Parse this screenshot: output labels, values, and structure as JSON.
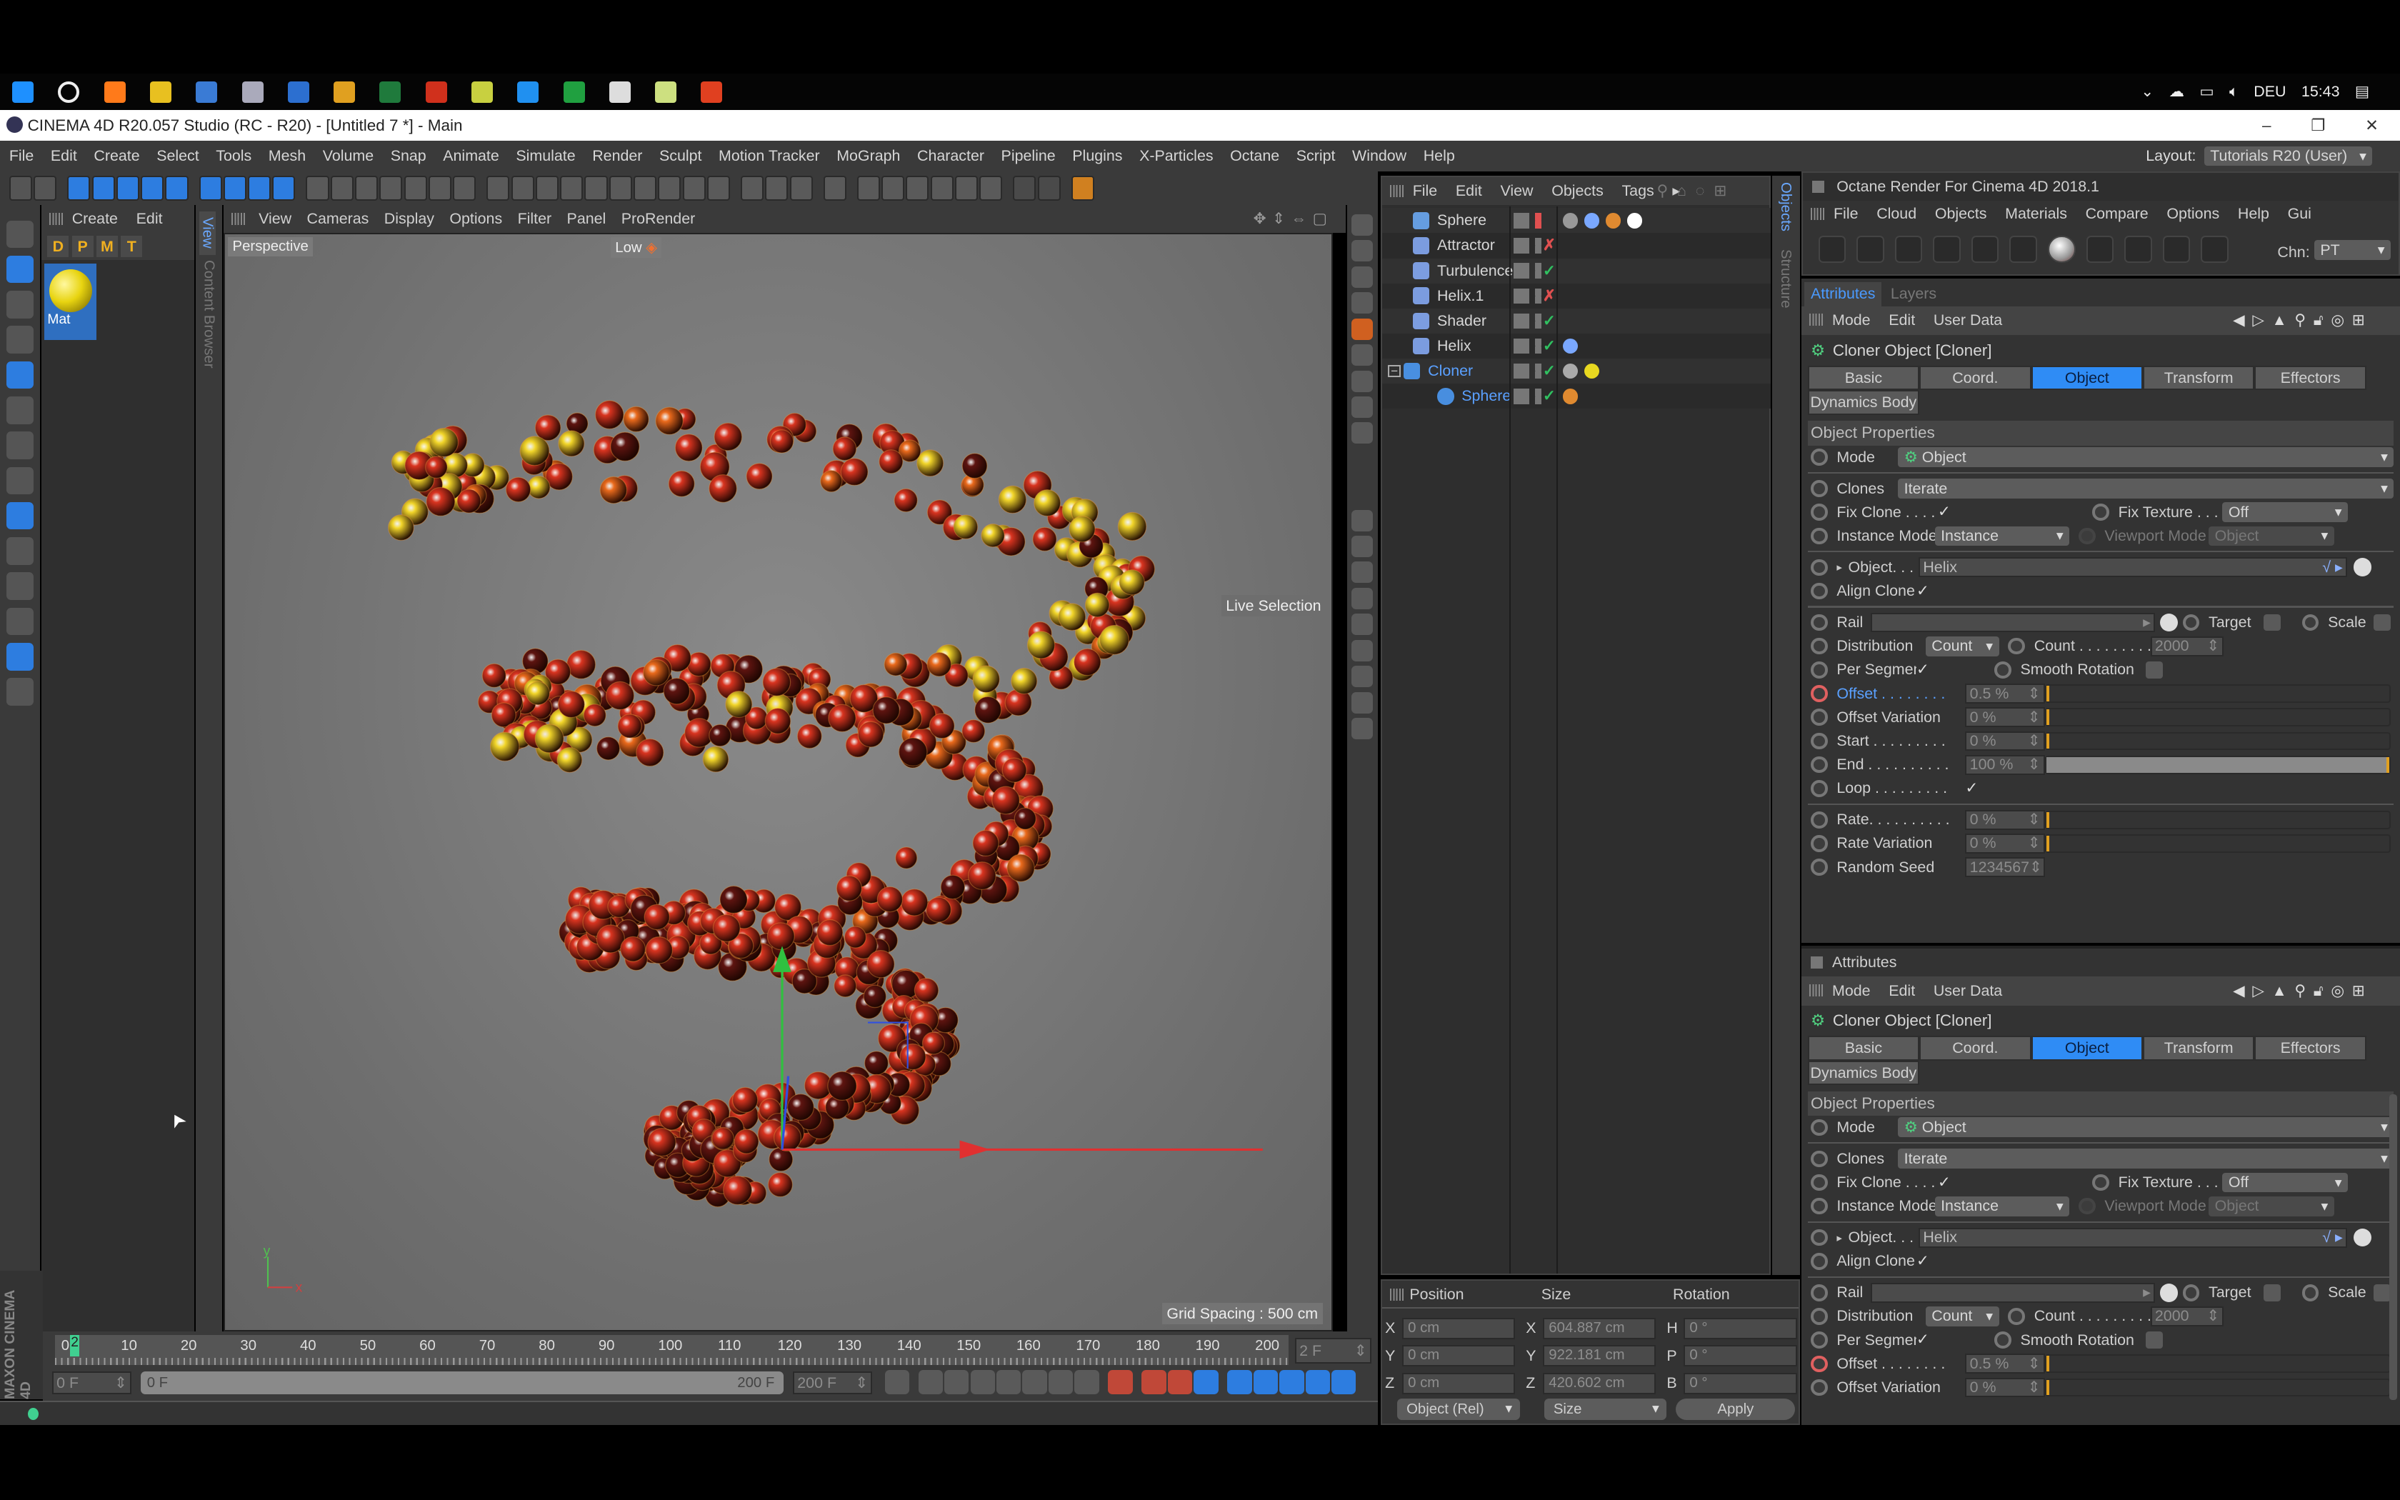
{
  "taskbar": {
    "apps": [
      "windows-icon",
      "cortana-icon",
      "firefox-icon",
      "chrome-icon",
      "simplenote-icon",
      "cinema4d-icon",
      "photoshop-icon",
      "premiere-icon",
      "excel-icon",
      "acrobat-icon",
      "quixel-icon",
      "skype-icon",
      "camtasia-icon",
      "c4d-launcher-icon",
      "notepad-icon",
      "recorder-icon"
    ],
    "lang": "DEU",
    "time": "15:43"
  },
  "window": {
    "title": "CINEMA 4D R20.057 Studio (RC - R20) - [Untitled 7 *] - Main",
    "minimize": "–",
    "restore": "❐",
    "close": "✕"
  },
  "menu": [
    "File",
    "Edit",
    "Create",
    "Select",
    "Tools",
    "Mesh",
    "Volume",
    "Snap",
    "Animate",
    "Simulate",
    "Render",
    "Sculpt",
    "Motion Tracker",
    "MoGraph",
    "Character",
    "Pipeline",
    "Plugins",
    "X-Particles",
    "Octane",
    "Script",
    "Window",
    "Help"
  ],
  "layout": {
    "label": "Layout:",
    "value": "Tutorials R20 (User)"
  },
  "material_panel": {
    "menu": [
      "Create",
      "Edit"
    ],
    "filters": [
      "D",
      "P",
      "M",
      "T"
    ],
    "material": "Mat",
    "vertical_tab": "Content Browser",
    "view_tab": "View"
  },
  "viewport": {
    "menu": [
      "View",
      "Cameras",
      "Display",
      "Options",
      "Filter",
      "Panel",
      "ProRender"
    ],
    "camera": "Perspective",
    "quality": "Low",
    "tool": "Live Selection",
    "grid": "Grid Spacing : 500 cm",
    "axis_x": "x",
    "axis_y": "y",
    "sphere_colors": {
      "red": "#d93420",
      "orange": "#ea6a1c",
      "dark": "#5e1410",
      "yellow": "#f2d62a"
    }
  },
  "objects": {
    "menu": [
      "File",
      "Edit",
      "View",
      "Objects",
      "Tags"
    ],
    "items": [
      {
        "name": "Sphere",
        "icon": "sphere-generator-icon",
        "color": "#6fb0ff",
        "status": ""
      },
      {
        "name": "Attractor",
        "icon": "attractor-icon",
        "color": "#8ab0ff",
        "status": "✗"
      },
      {
        "name": "Turbulence",
        "icon": "turbulence-icon",
        "color": "#8ab0ff",
        "status": "✓"
      },
      {
        "name": "Helix.1",
        "icon": "helix-spline-icon",
        "color": "#8ab0ff",
        "status": "✗"
      },
      {
        "name": "Shader",
        "icon": "shader-field-icon",
        "color": "#8ab0ff",
        "status": "✓"
      },
      {
        "name": "Helix",
        "icon": "helix-spline-icon",
        "color": "#8ab0ff",
        "status": "✓"
      },
      {
        "name": "Cloner",
        "icon": "cloner-icon",
        "color": "#4ea0ff",
        "status": "✓"
      },
      {
        "name": "Sphere",
        "icon": "sphere-icon",
        "color": "#4ea0ff",
        "status": "✓"
      }
    ],
    "side_tabs": [
      "Objects",
      "Structure"
    ]
  },
  "coords": {
    "headers": [
      "Position",
      "Size",
      "Rotation"
    ],
    "position": [
      {
        "axis": "X",
        "value": "0 cm"
      },
      {
        "axis": "Y",
        "value": "0 cm"
      },
      {
        "axis": "Z",
        "value": "0 cm"
      }
    ],
    "size": [
      {
        "axis": "X",
        "value": "604.887 cm"
      },
      {
        "axis": "Y",
        "value": "922.181 cm"
      },
      {
        "axis": "Z",
        "value": "420.602 cm"
      }
    ],
    "rotation": [
      {
        "axis": "H",
        "value": "0 °"
      },
      {
        "axis": "P",
        "value": "0 °"
      },
      {
        "axis": "B",
        "value": "0 °"
      }
    ],
    "mode": "Object (Rel)",
    "size_mode": "Size",
    "apply": "Apply"
  },
  "timeline": {
    "ticks": [
      "0",
      "10",
      "20",
      "30",
      "40",
      "50",
      "60",
      "70",
      "80",
      "90",
      "100",
      "110",
      "120",
      "130",
      "140",
      "150",
      "160",
      "170",
      "180",
      "190",
      "200"
    ],
    "current_frame": 2,
    "current_label": "2",
    "current_field": "2 F",
    "start_field": "0 F",
    "range_start": "0 F",
    "range_end": "200 F",
    "end_field": "200 F",
    "brand": "MAXON CINEMA 4D"
  },
  "octane": {
    "title": "Octane Render For Cinema 4D 2018.1",
    "menu": [
      "File",
      "Cloud",
      "Objects",
      "Materials",
      "Compare",
      "Options",
      "Help",
      "Gui"
    ],
    "chn_label": "Chn:",
    "chn_value": "PT"
  },
  "attributes": {
    "tabs_top": [
      "Attributes",
      "Layers"
    ],
    "panel2_title": "Attributes",
    "mode_menu": [
      "Mode",
      "Edit",
      "User Data"
    ],
    "object_title": "Cloner Object [Cloner]",
    "tabs": [
      "Basic",
      "Coord.",
      "Object",
      "Transform",
      "Effectors",
      "Dynamics Body"
    ],
    "active_tab": "Object",
    "section": "Object Properties",
    "fields": {
      "mode": {
        "label": "Mode",
        "value": "Object"
      },
      "clones": {
        "label": "Clones",
        "value": "Iterate"
      },
      "fix_clone": {
        "label": "Fix Clone . . . .",
        "checked": true
      },
      "fix_texture": {
        "label": "Fix Texture . . . .",
        "value": "Off"
      },
      "instance_mode": {
        "label": "Instance Mode",
        "value": "Instance"
      },
      "viewport_mode": {
        "label": "Viewport Mode",
        "value": "Object"
      },
      "object": {
        "label": "Object. . .",
        "value": "Helix"
      },
      "align_clone": {
        "label": "Align Clone",
        "checked": true
      },
      "rail": {
        "label": "Rail",
        "value": ""
      },
      "target": {
        "label": "Target",
        "checked": false
      },
      "scale": {
        "label": "Scale",
        "checked": false
      },
      "distribution": {
        "label": "Distribution",
        "value": "Count"
      },
      "count": {
        "label": "Count . . . . . . . . .",
        "value": "2000"
      },
      "per_segment": {
        "label": "Per Segment",
        "checked": true
      },
      "smooth_rotation": {
        "label": "Smooth Rotation",
        "checked": false
      },
      "offset": {
        "label": "Offset . . . . . . . .",
        "value": "0.5 %",
        "percent": 0.5
      },
      "offset_variation": {
        "label": "Offset Variation",
        "value": "0 %",
        "percent": 0
      },
      "start": {
        "label": "Start . . . . . . . . .",
        "value": "0 %",
        "percent": 0
      },
      "end": {
        "label": "End . . . . . . . . . .",
        "value": "100 %",
        "percent": 100
      },
      "loop": {
        "label": "Loop . . . . . . . . .",
        "checked": true
      },
      "rate": {
        "label": "Rate. . . . . . . . . .",
        "value": "0 %",
        "percent": 0
      },
      "rate_variation": {
        "label": "Rate Variation",
        "value": "0 %",
        "percent": 0
      },
      "random_seed": {
        "label": "Random Seed",
        "value": "1234567"
      }
    }
  }
}
